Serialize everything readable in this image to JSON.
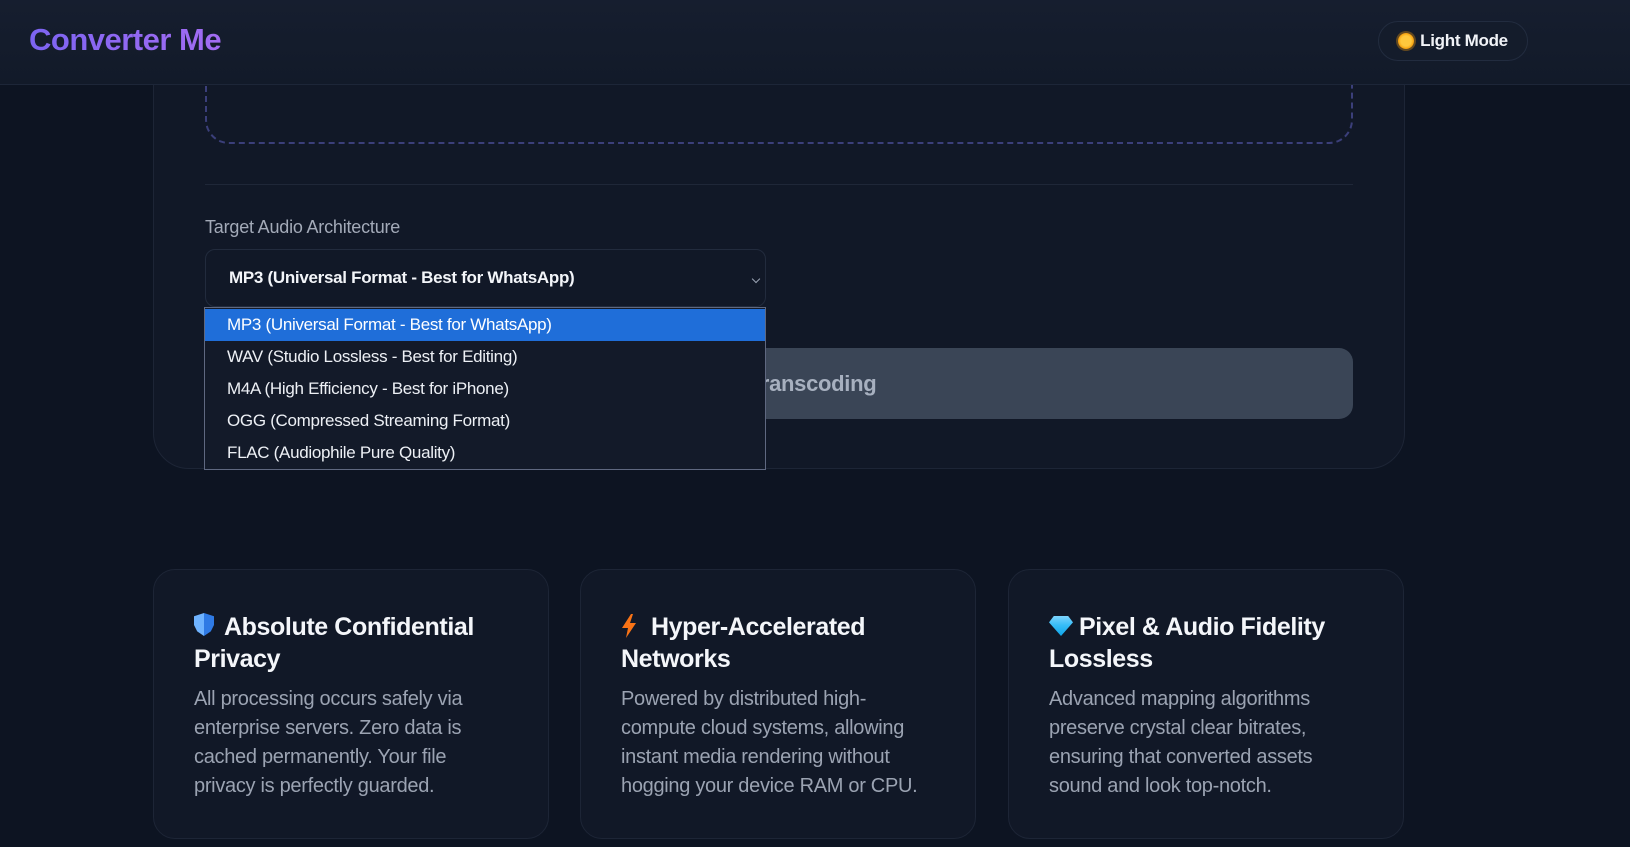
{
  "header": {
    "logo": "Converter Me",
    "mode_toggle_label": "Light Mode",
    "mode_icon": "sun-icon"
  },
  "converter": {
    "field_label": "Target Audio Architecture",
    "selected_format": "MP3 (Universal Format - Best for WhatsApp)",
    "convert_button_label": "idelity Transcoding",
    "format_options": [
      "MP3 (Universal Format - Best for WhatsApp)",
      "WAV (Studio Lossless - Best for Editing)",
      "M4A (High Efficiency - Best for iPhone)",
      "OGG (Compressed Streaming Format)",
      "FLAC (Audiophile Pure Quality)"
    ],
    "highlighted_option_index": 0
  },
  "features": [
    {
      "icon": "shield-icon",
      "title": "Absolute Confidential Privacy",
      "description": "All processing occurs safely via enterprise servers. Zero data is cached permanently. Your file privacy is perfectly guarded."
    },
    {
      "icon": "lightning-icon",
      "title": "Hyper-Accelerated Networks",
      "description": "Powered by distributed high-compute cloud systems, allowing instant media rendering without hogging your device RAM or CPU."
    },
    {
      "icon": "gem-icon",
      "title": "Pixel & Audio Fidelity Lossless",
      "description": "Advanced mapping algorithms preserve crystal clear bitrates, ensuring that converted assets sound and look top-notch."
    }
  ],
  "colors": {
    "background": "#0d1422",
    "card": "#111827",
    "accent_logo": "#8b6cf0",
    "option_highlight": "#1f6ed9",
    "button_disabled": "#3a4556"
  }
}
